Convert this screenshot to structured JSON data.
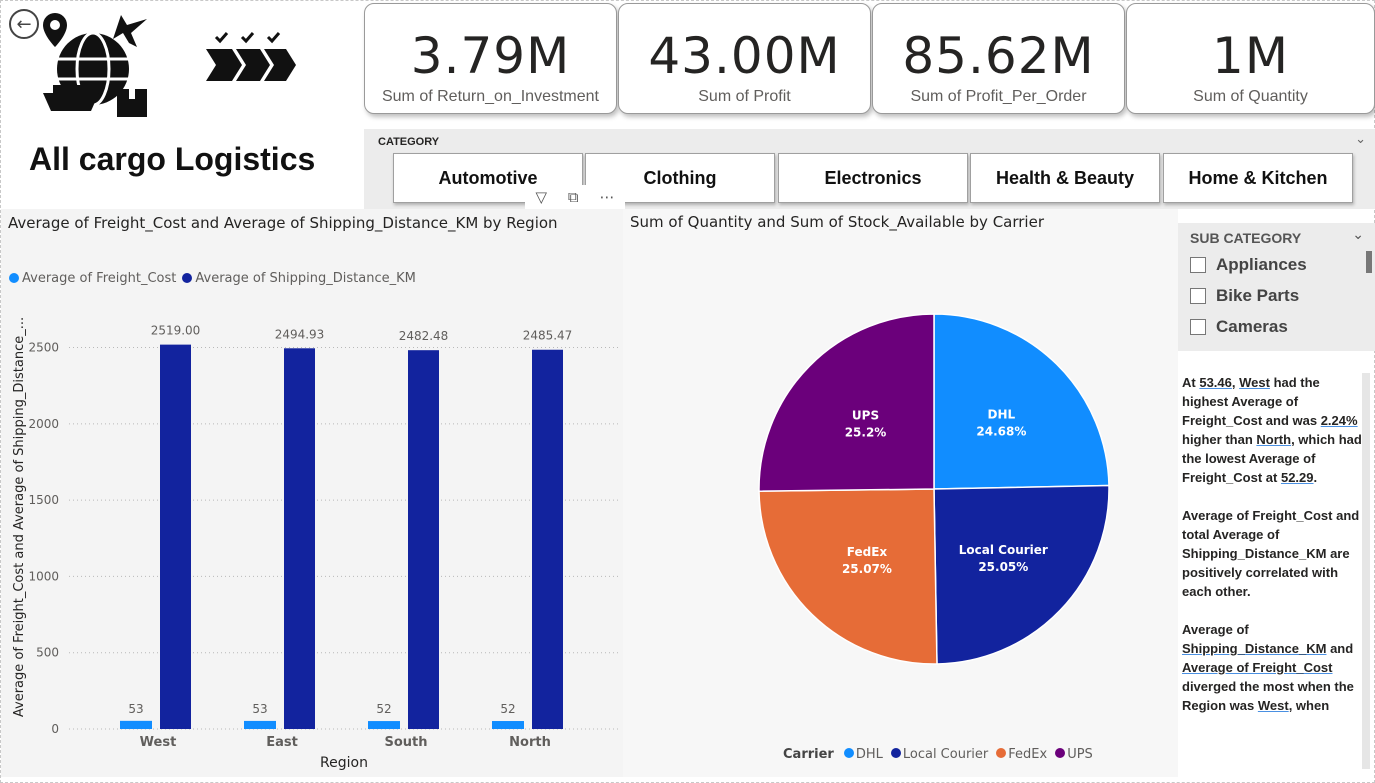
{
  "header": {
    "title": "All cargo Logistics",
    "back_icon": "back-arrow-icon",
    "logo_icon": "globe-logistics-icon",
    "process_icon": "checklist-chevrons-icon"
  },
  "kpis": [
    {
      "value": "3.79M",
      "label": "Sum of Return_on_Investment"
    },
    {
      "value": "43.00M",
      "label": "Sum of Profit"
    },
    {
      "value": "85.62M",
      "label": "Sum of Profit_Per_Order"
    },
    {
      "value": "1M",
      "label": "Sum of Quantity"
    }
  ],
  "category_slicer": {
    "title": "CATEGORY",
    "items": [
      "Automotive",
      "Clothing",
      "Electronics",
      "Health & Beauty",
      "Home & Kitchen"
    ]
  },
  "visual_toolbar": {
    "filter_icon": "filter-icon",
    "focus_icon": "focus-mode-icon",
    "more_icon": "more-options-icon"
  },
  "bar_chart": {
    "title": "Average of Freight_Cost and Average of Shipping_Distance_KM by Region",
    "legend": [
      "Average of Freight_Cost",
      "Average of Shipping_Distance_KM"
    ],
    "xlabel": "Region",
    "ylabel": "Average of Freight_Cost and Average of Shipping_Distance_..."
  },
  "pie_chart": {
    "title": "Sum of Quantity and Sum of Stock_Available by Carrier",
    "legend_title": "Carrier"
  },
  "sub_category_slicer": {
    "title": "SUB CATEGORY",
    "items": [
      "Appliances",
      "Bike Parts",
      "Cameras"
    ]
  },
  "narrative": {
    "p1": [
      "At ",
      "53.46",
      ", ",
      "West",
      " had the highest Average of Freight_Cost and was ",
      "2.24%",
      " higher than ",
      "North",
      ", which had the lowest Average of Freight_Cost at ",
      "52.29",
      "."
    ],
    "p2": "Average of Freight_Cost and total Average of Shipping_Distance_KM are positively correlated with each other.",
    "p3": [
      "Average of ",
      "Shipping_Distance_KM",
      " and ",
      "Average of Freight_Cost",
      " diverged the most when the Region was ",
      "West",
      ", when"
    ]
  },
  "chart_data": [
    {
      "type": "bar",
      "title": "Average of Freight_Cost and Average of Shipping_Distance_KM by Region",
      "categories": [
        "West",
        "East",
        "South",
        "North"
      ],
      "series": [
        {
          "name": "Average of Freight_Cost",
          "values": [
            53.46,
            53.0,
            52.0,
            52.29
          ],
          "labels": [
            "53",
            "53",
            "52",
            "52"
          ],
          "color": "#118DFF"
        },
        {
          "name": "Average of Shipping_Distance_KM",
          "values": [
            2519.0,
            2494.93,
            2482.48,
            2485.47
          ],
          "labels": [
            "2519.00",
            "2494.93",
            "2482.48",
            "2485.47"
          ],
          "color": "#12239E"
        }
      ],
      "yticks": [
        0,
        500,
        1000,
        1500,
        2000,
        2500
      ],
      "ylim": [
        0,
        2700
      ],
      "xlabel": "Region",
      "ylabel": "Average of Freight_Cost and Average of Shipping_Distance_...",
      "grid": true,
      "legend_position": "top-left"
    },
    {
      "type": "pie",
      "title": "Sum of Quantity and Sum of Stock_Available by Carrier",
      "categories": [
        "DHL",
        "Local Courier",
        "FedEx",
        "UPS"
      ],
      "values": [
        24.68,
        25.05,
        25.07,
        25.2
      ],
      "labels": [
        "24.68%",
        "25.05%",
        "25.07%",
        "25.2%"
      ],
      "colors": [
        "#118DFF",
        "#12239E",
        "#E66C37",
        "#6B007B"
      ],
      "legend_title": "Carrier",
      "legend_position": "bottom"
    }
  ]
}
